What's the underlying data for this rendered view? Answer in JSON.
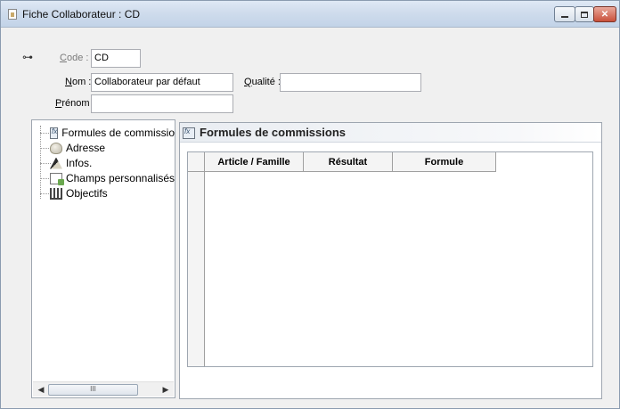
{
  "window": {
    "title": "Fiche Collaborateur : CD"
  },
  "form": {
    "code_label": "Code :",
    "code_accel": "C",
    "code_rest": "ode :",
    "code_value": "CD",
    "nom_accel": "N",
    "nom_rest": "om :",
    "nom_value": "Collaborateur par défaut",
    "qualite_accel": "Q",
    "qualite_rest": "ualité :",
    "qualite_value": "",
    "prenom_accel": "P",
    "prenom_rest": "rénom :",
    "prenom_value": ""
  },
  "tree": {
    "items": [
      {
        "label": "Formules de commissio",
        "icon": "formula-icon"
      },
      {
        "label": "Adresse",
        "icon": "address-icon"
      },
      {
        "label": "Infos.",
        "icon": "info-icon"
      },
      {
        "label": "Champs personnalisés",
        "icon": "custom-fields-icon"
      },
      {
        "label": "Objectifs",
        "icon": "objectives-icon"
      }
    ],
    "scroll_thumb": "III"
  },
  "panel": {
    "title": "Formules de commissions",
    "columns": [
      "Article / Famille",
      "Résultat",
      "Formule"
    ]
  }
}
